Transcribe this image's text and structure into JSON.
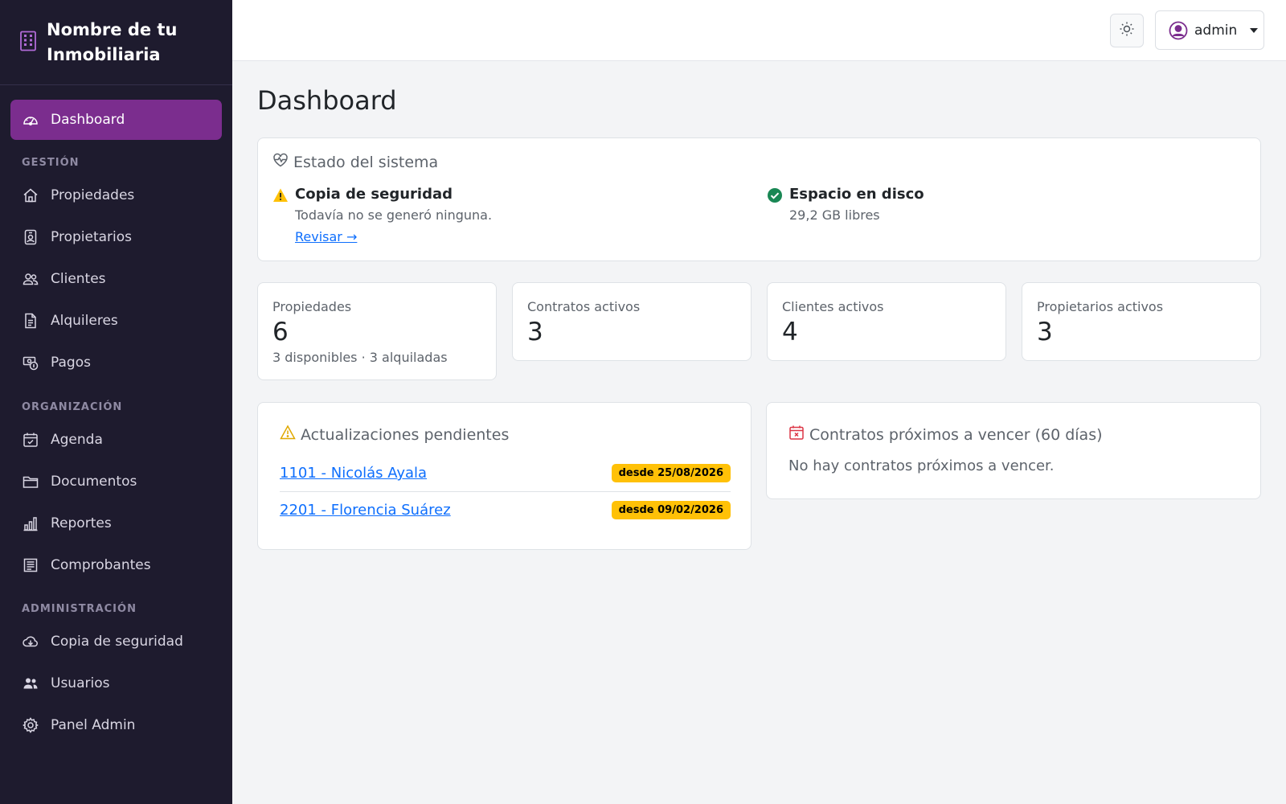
{
  "brand": {
    "name_line1": "Nombre de tu",
    "name_line2": "Inmobiliaria"
  },
  "sidebar": {
    "active": {
      "label": "Dashboard",
      "icon": "speedometer-icon"
    },
    "sections": [
      {
        "label": "GESTIÓN",
        "items": [
          {
            "label": "Propiedades",
            "icon": "house-icon"
          },
          {
            "label": "Propietarios",
            "icon": "person-badge-icon"
          },
          {
            "label": "Clientes",
            "icon": "people-icon"
          },
          {
            "label": "Alquileres",
            "icon": "file-text-icon"
          },
          {
            "label": "Pagos",
            "icon": "cash-coin-icon"
          }
        ]
      },
      {
        "label": "ORGANIZACIÓN",
        "items": [
          {
            "label": "Agenda",
            "icon": "calendar-check-icon"
          },
          {
            "label": "Documentos",
            "icon": "folder-icon"
          },
          {
            "label": "Reportes",
            "icon": "bar-chart-icon"
          },
          {
            "label": "Comprobantes",
            "icon": "receipt-icon"
          }
        ]
      },
      {
        "label": "ADMINISTRACIÓN",
        "items": [
          {
            "label": "Copia de seguridad",
            "icon": "cloud-download-icon"
          },
          {
            "label": "Usuarios",
            "icon": "people-fill-icon"
          },
          {
            "label": "Panel Admin",
            "icon": "gear-icon"
          }
        ]
      }
    ]
  },
  "header": {
    "user_label": "admin",
    "theme_icon": "sun-icon"
  },
  "main": {
    "title": "Dashboard",
    "status": {
      "title": "Estado del sistema",
      "backup": {
        "title": "Copia de seguridad",
        "desc": "Todavía no se generó ninguna.",
        "link": "Revisar →"
      },
      "disk": {
        "title": "Espacio en disco",
        "desc": "29,2 GB libres"
      }
    },
    "stats": [
      {
        "label": "Propiedades",
        "value": "6",
        "sub": "3 disponibles · 3 alquiladas"
      },
      {
        "label": "Contratos activos",
        "value": "3"
      },
      {
        "label": "Clientes activos",
        "value": "4"
      },
      {
        "label": "Propietarios activos",
        "value": "3"
      }
    ],
    "pending": {
      "title": "Actualizaciones pendientes",
      "rows": [
        {
          "label": "1101 - Nicolás Ayala",
          "badge": "desde 25/08/2026"
        },
        {
          "label": "2201 - Florencia Suárez",
          "badge": "desde 09/02/2026"
        }
      ]
    },
    "expiring": {
      "title": "Contratos próximos a vencer (60 días)",
      "empty": "No hay contratos próximos a vencer."
    }
  },
  "colors": {
    "sidebar_bg": "#1e1b2e",
    "accent": "#7b2d8e",
    "warning": "#ffc107",
    "success": "#198754",
    "link": "#0d6efd",
    "danger": "#dc3545"
  }
}
